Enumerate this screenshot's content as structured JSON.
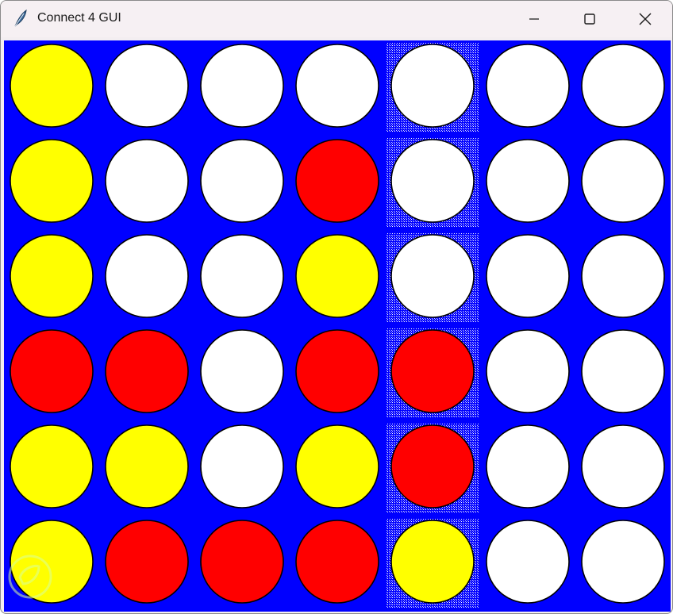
{
  "window": {
    "title": "Connect 4 GUI",
    "icon": "feather-icon",
    "controls": [
      "minimize-icon",
      "maximize-icon",
      "close-icon"
    ]
  },
  "board": {
    "rows": 6,
    "columns": 7,
    "highlighted_column": 4,
    "colors": {
      "board": "#0000ff",
      "empty": "#ffffff",
      "yellow": "#ffff00",
      "red": "#ff0000",
      "outline": "#000000"
    },
    "cells": [
      [
        "yellow",
        "empty",
        "empty",
        "empty",
        "empty",
        "empty",
        "empty"
      ],
      [
        "yellow",
        "empty",
        "empty",
        "red",
        "empty",
        "empty",
        "empty"
      ],
      [
        "yellow",
        "empty",
        "empty",
        "yellow",
        "empty",
        "empty",
        "empty"
      ],
      [
        "red",
        "red",
        "empty",
        "red",
        "red",
        "empty",
        "empty"
      ],
      [
        "yellow",
        "yellow",
        "empty",
        "yellow",
        "red",
        "empty",
        "empty"
      ],
      [
        "yellow",
        "red",
        "red",
        "red",
        "yellow",
        "empty",
        "empty"
      ]
    ]
  }
}
